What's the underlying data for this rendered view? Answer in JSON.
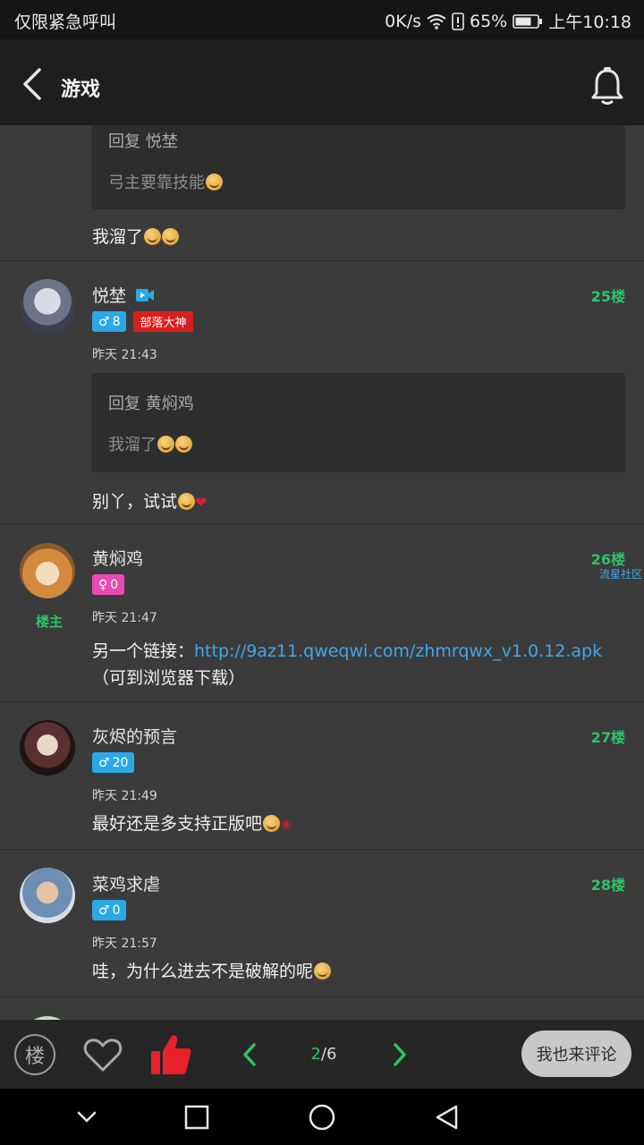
{
  "status_bar": {
    "carrier": "仅限紧急呼叫",
    "speed": "0K/s",
    "battery": "65%",
    "time": "上午10:18"
  },
  "header": {
    "title": "游戏"
  },
  "posts": [
    {
      "quote_head": "回复 悦埜",
      "quote_text": "弓主要靠技能",
      "content": "我溜了"
    },
    {
      "username": "悦埜",
      "floor": "25楼",
      "gender": "♂",
      "level": "8",
      "title_badge": "部落大神",
      "time": "昨天 21:43",
      "quote_head": "回复 黄焖鸡",
      "quote_text": "我溜了",
      "content": "别丫，试试"
    },
    {
      "username": "黄焖鸡",
      "floor": "26楼",
      "gender": "♀",
      "level": "0",
      "louzhu": "楼主",
      "watermark": "流星社区",
      "time": "昨天 21:47",
      "content_prefix": "另一个链接：",
      "link": "http://9az11.qweqwi.com/zhmrqwx_v1.0.12.apk",
      "content_suffix": "（可到浏览器下载）"
    },
    {
      "username": "灰烬的预言",
      "floor": "27楼",
      "gender": "♂",
      "level": "20",
      "time": "昨天 21:49",
      "content": "最好还是多支持正版吧"
    },
    {
      "username": "菜鸡求虐",
      "floor": "28楼",
      "gender": "♂",
      "level": "0",
      "time": "昨天 21:57",
      "content": "哇，为什么进去不是破解的呢"
    }
  ],
  "action_bar": {
    "floor_label": "楼",
    "page_current": "2",
    "page_sep": "/",
    "page_total": "6",
    "comment_label": "我也来评论"
  },
  "icons": [
    "back-arrow-icon",
    "bell-icon",
    "heart-icon",
    "thumbs-up-icon",
    "chevron-left-icon",
    "chevron-right-icon"
  ],
  "colors": {
    "accent_green": "#2fc26a",
    "link_blue": "#3fa8ea",
    "like_red": "#e8202a",
    "male_blue": "#2ba9e6",
    "female_pink": "#e84bb3"
  }
}
